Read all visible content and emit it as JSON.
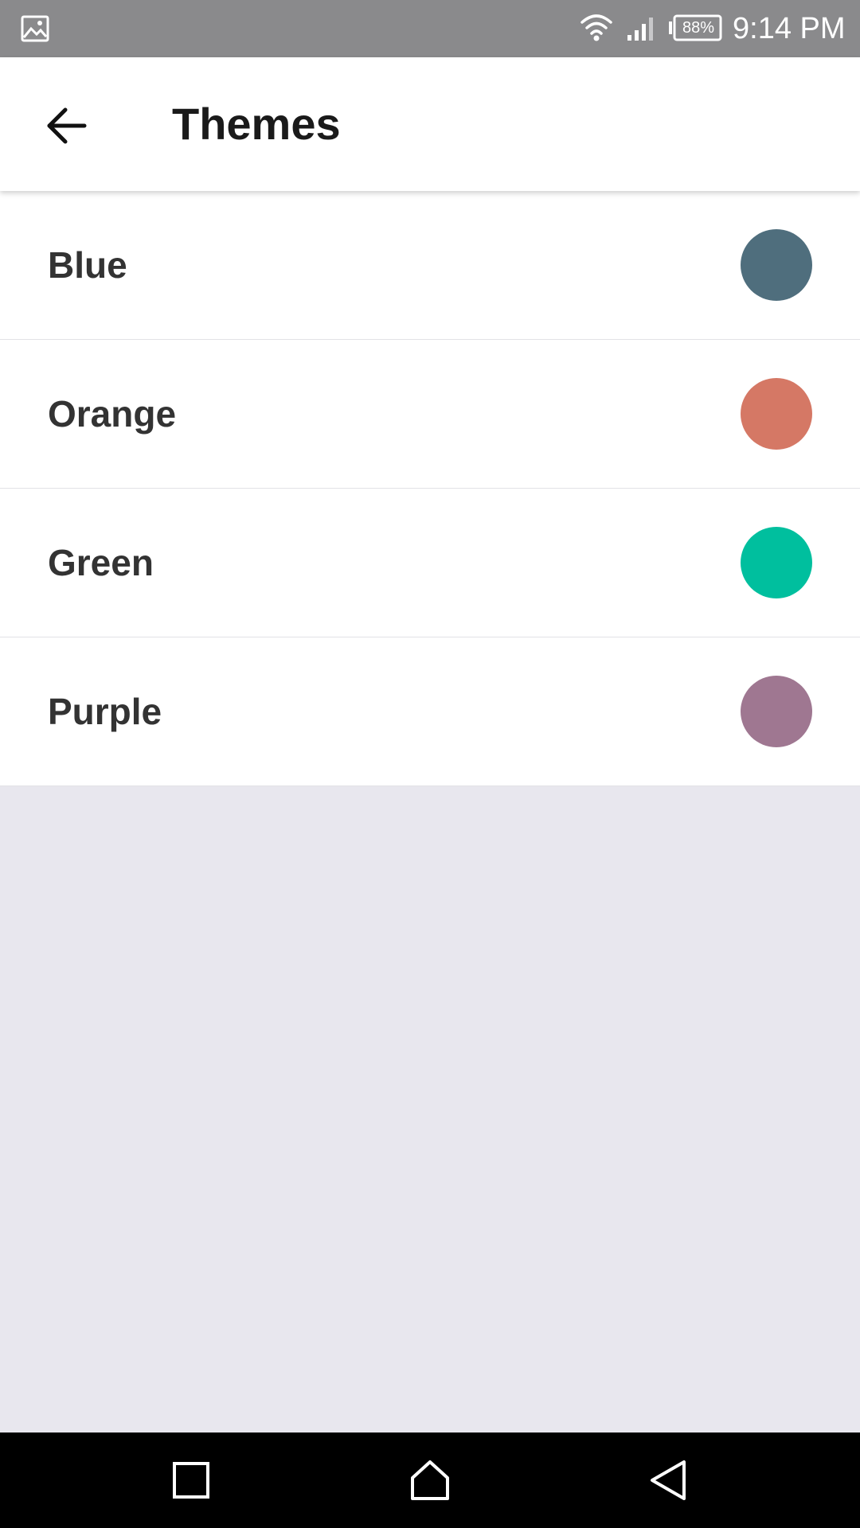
{
  "status_bar": {
    "time": "9:14 PM",
    "battery": "88%",
    "icons": [
      "gallery-icon",
      "wifi-icon",
      "signal-icon",
      "battery-icon"
    ]
  },
  "app_bar": {
    "title": "Themes",
    "back_icon": "arrow-left-icon"
  },
  "themes": [
    {
      "label": "Blue",
      "color": "#4f6e7d"
    },
    {
      "label": "Orange",
      "color": "#d57865"
    },
    {
      "label": "Green",
      "color": "#00bf9e"
    },
    {
      "label": "Purple",
      "color": "#9f7791"
    }
  ],
  "nav_bar": {
    "icons": [
      "recents-icon",
      "home-icon",
      "back-icon"
    ]
  },
  "colors": {
    "status_bar_bg": "#8a8a8c",
    "background": "#e8e7ee",
    "nav_bar_bg": "#000000"
  }
}
